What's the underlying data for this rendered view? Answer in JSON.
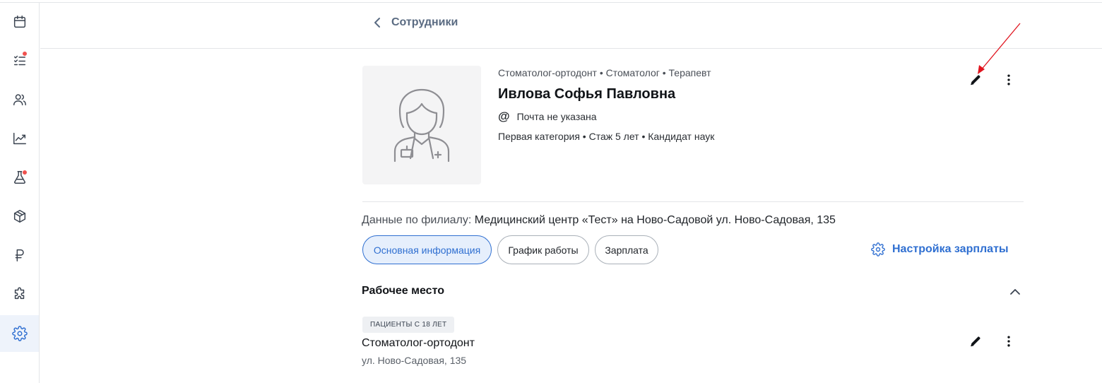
{
  "header": {
    "back_label": "Сотрудники"
  },
  "sidebar": {
    "items": [
      {
        "name": "calendar",
        "icon": "calendar-icon",
        "active": false,
        "notification": false
      },
      {
        "name": "tasks",
        "icon": "checklist-icon",
        "active": false,
        "notification": true
      },
      {
        "name": "patients",
        "icon": "users-icon",
        "active": false,
        "notification": false
      },
      {
        "name": "analytics",
        "icon": "trend-chart-icon",
        "active": false,
        "notification": false
      },
      {
        "name": "lab",
        "icon": "flask-icon",
        "active": false,
        "notification": true
      },
      {
        "name": "warehouse",
        "icon": "box-icon",
        "active": false,
        "notification": false
      },
      {
        "name": "finance",
        "icon": "ruble-icon",
        "active": false,
        "notification": false
      },
      {
        "name": "integrations",
        "icon": "puzzle-icon",
        "active": false,
        "notification": false
      },
      {
        "name": "settings",
        "icon": "gear-icon",
        "active": true,
        "notification": false
      }
    ]
  },
  "employee": {
    "specialties": "Стоматолог-ортодонт • Стоматолог • Терапевт",
    "name": "Ивлова Софья Павловна",
    "email_icon": "at-icon",
    "email": "Почта не указана",
    "qualifications": "Первая категория • Стаж 5 лет • Кандидат наук",
    "avatar_icon": "female-doctor-placeholder-icon"
  },
  "branch": {
    "label": "Данные по филиалу:",
    "value": "Медицинский центр «Тест» на Ново-Садовой ул. Ново-Садовая, 135"
  },
  "tabs": [
    {
      "label": "Основная информация",
      "active": true
    },
    {
      "label": "График работы",
      "active": false
    },
    {
      "label": "Зарплата",
      "active": false
    }
  ],
  "salary_settings": {
    "label": "Настройка зарплаты",
    "icon": "gear-icon"
  },
  "workplace_section": {
    "title": "Рабочее место",
    "expanded": true,
    "items": [
      {
        "badge": "ПАЦИЕНТЫ С 18 ЛЕТ",
        "title": "Стоматолог-ортодонт",
        "address": "ул. Ново-Садовая, 135"
      }
    ]
  },
  "annotation": {
    "type": "arrow",
    "color": "#e0141e"
  },
  "colors": {
    "accent": "#2f6fd1",
    "active_tab_bg": "#e6effc",
    "notification_dot": "#f0524f"
  }
}
